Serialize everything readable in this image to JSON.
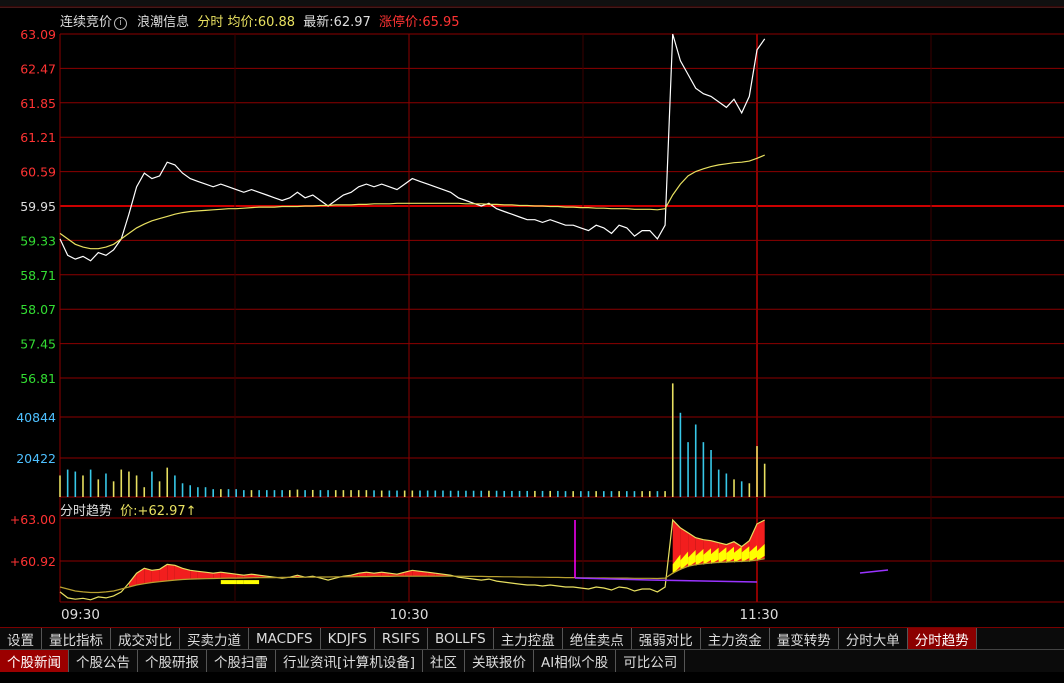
{
  "header": {
    "auction_label": "连续竞价",
    "auction_icon": "info-circle-icon",
    "news_label": "浪潮信息",
    "mode_label": "分时",
    "avg_label": "均价:",
    "avg_value": "60.88",
    "last_label": "最新:",
    "last_value": "62.97",
    "limit_label": "涨停价:",
    "limit_value": "65.95"
  },
  "price_axis": {
    "labels": [
      "63.09",
      "62.47",
      "61.85",
      "61.21",
      "60.59",
      "59.95",
      "59.33",
      "58.71",
      "58.07",
      "57.45",
      "56.81"
    ],
    "base": "59.95"
  },
  "volume_axis": {
    "labels": [
      "40844",
      "20422"
    ]
  },
  "sub_panel": {
    "title": "分时趋势",
    "price_label": "价:",
    "price_value": "+62.97↑",
    "axis": [
      "+63.00",
      "+60.92"
    ]
  },
  "time_axis": [
    "09:30",
    "10:30",
    "11:30"
  ],
  "indicator_tabs": [
    "设置",
    "量比指标",
    "成交对比",
    "买卖力道",
    "MACDFS",
    "KDJFS",
    "RSIFS",
    "BOLLFS",
    "主力控盘",
    "绝佳卖点",
    "强弱对比",
    "主力资金",
    "量变转势",
    "分时大单",
    "分时趋势"
  ],
  "indicator_active": 14,
  "news_tabs": [
    "个股新闻",
    "个股公告",
    "个股研报",
    "个股扫雷",
    "行业资讯[计算机设备]",
    "社区",
    "关联报价",
    "AI相似个股",
    "可比公司"
  ],
  "news_active": 0,
  "colors": {
    "up": "#ff3333",
    "down": "#33dd33",
    "grid": "#8b0000",
    "price_line": "#ffffff",
    "avg_line": "#e8e060",
    "volume_cyan": "#38c8e8",
    "volume_yellow": "#e8e060",
    "label_blue": "#4ec0ff",
    "fill_red": "#ff2020",
    "fill_yellow": "#ffff00",
    "magenta": "#ff00ff",
    "purple": "#9933ff"
  },
  "chart_data": {
    "type": "line",
    "title": "",
    "xlabel": "",
    "ylabel": "",
    "x_ticks": [
      "09:30",
      "10:30",
      "11:30"
    ],
    "ylim": [
      56.81,
      63.09
    ],
    "series": [
      {
        "values": [
          59.35,
          59.05,
          58.98,
          59.03,
          58.95,
          59.1,
          59.05,
          59.15,
          59.35,
          59.8,
          60.3,
          60.55,
          60.45,
          60.5,
          60.75,
          60.7,
          60.55,
          60.45,
          60.4,
          60.35,
          60.3,
          60.35,
          60.3,
          60.25,
          60.2,
          60.25,
          60.2,
          60.15,
          60.1,
          60.05,
          60.1,
          60.2,
          60.1,
          60.15,
          60.05,
          59.95,
          60.05,
          60.15,
          60.2,
          60.3,
          60.35,
          60.3,
          60.35,
          60.3,
          60.25,
          60.35,
          60.45,
          60.4,
          60.35,
          60.3,
          60.25,
          60.2,
          60.1,
          60.05,
          60.0,
          59.95,
          60.0,
          59.9,
          59.85,
          59.8,
          59.75,
          59.7,
          59.7,
          59.65,
          59.7,
          59.65,
          59.6,
          59.6,
          59.55,
          59.5,
          59.6,
          59.55,
          59.45,
          59.6,
          59.55,
          59.4,
          59.5,
          59.5,
          59.35,
          59.6,
          63.09,
          62.6,
          62.35,
          62.1,
          62.0,
          61.95,
          61.85,
          61.75,
          61.9,
          61.65,
          61.95,
          62.8,
          63.0
        ]
      },
      {
        "values": [
          59.45,
          59.35,
          59.25,
          59.2,
          59.17,
          59.17,
          59.2,
          59.25,
          59.35,
          59.45,
          59.55,
          59.62,
          59.68,
          59.72,
          59.76,
          59.8,
          59.83,
          59.85,
          59.86,
          59.87,
          59.88,
          59.89,
          59.9,
          59.9,
          59.91,
          59.92,
          59.93,
          59.93,
          59.93,
          59.94,
          59.94,
          59.94,
          59.95,
          59.95,
          59.96,
          59.96,
          59.97,
          59.97,
          59.97,
          59.98,
          59.98,
          59.99,
          59.99,
          59.99,
          60.0,
          60.0,
          60.0,
          60.0,
          60.0,
          60.0,
          60.0,
          60.0,
          60.0,
          59.99,
          59.99,
          59.99,
          59.98,
          59.98,
          59.97,
          59.97,
          59.96,
          59.96,
          59.95,
          59.95,
          59.94,
          59.94,
          59.93,
          59.93,
          59.92,
          59.92,
          59.91,
          59.91,
          59.9,
          59.9,
          59.9,
          59.89,
          59.89,
          59.89,
          59.88,
          59.9,
          60.15,
          60.35,
          60.5,
          60.58,
          60.63,
          60.67,
          60.7,
          60.72,
          60.74,
          60.75,
          60.77,
          60.82,
          60.88
        ]
      }
    ],
    "volume": [
      11000,
      14000,
      13000,
      11000,
      14000,
      9000,
      12000,
      8000,
      14000,
      13000,
      11000,
      5000,
      13000,
      8000,
      15000,
      11000,
      7000,
      6000,
      5000,
      5000,
      4000,
      4000,
      4000,
      4000,
      3500,
      3500,
      3500,
      3500,
      3500,
      3500,
      3500,
      3800,
      3500,
      3600,
      3500,
      3500,
      3500,
      3500,
      3500,
      3500,
      3500,
      3400,
      3300,
      3300,
      3300,
      3300,
      3300,
      3300,
      3300,
      3300,
      3300,
      3200,
      3200,
      3200,
      3200,
      3200,
      3200,
      3200,
      3100,
      3100,
      3100,
      3100,
      3100,
      3100,
      3100,
      3100,
      3000,
      3000,
      3000,
      3000,
      3000,
      3000,
      3000,
      3000,
      3000,
      3000,
      3000,
      3000,
      3000,
      3000,
      58000,
      43000,
      28000,
      37000,
      28000,
      24000,
      14000,
      12000,
      9000,
      8000,
      7000,
      26000,
      17000
    ]
  }
}
